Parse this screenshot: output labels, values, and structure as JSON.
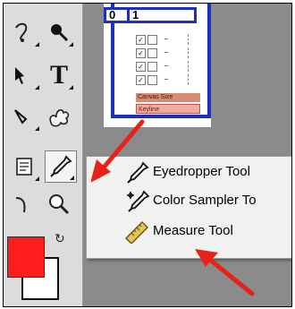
{
  "toolbox": {
    "tools": [
      {
        "name": "lasso-tool",
        "icon": "lasso-icon"
      },
      {
        "name": "quick-select-tool",
        "icon": "quick-select-icon"
      },
      {
        "name": "path-select-tool",
        "icon": "path-select-icon"
      },
      {
        "name": "type-tool",
        "icon": "type-icon",
        "glyph": "T"
      },
      {
        "name": "pen-tool",
        "icon": "pen-icon"
      },
      {
        "name": "custom-shape-tool",
        "icon": "custom-shape-icon"
      },
      {
        "name": "notes-tool",
        "icon": "notes-icon"
      },
      {
        "name": "eyedropper-tool",
        "icon": "eyedropper-icon",
        "selected": true
      },
      {
        "name": "hand-tool",
        "icon": "hand-icon"
      },
      {
        "name": "zoom-tool",
        "icon": "zoom-icon"
      }
    ],
    "foreground_color": "#ff1e1e",
    "background_color": "#ffffff"
  },
  "document": {
    "tabs": [
      "0",
      "1"
    ],
    "layer_labels": [
      "Canvas Size",
      "Keyline"
    ]
  },
  "flyout_menu": {
    "items": [
      {
        "label": "Eyedropper Tool",
        "icon": "eyedropper-icon",
        "current": true
      },
      {
        "label": "Color Sampler To",
        "icon": "color-sampler-icon"
      },
      {
        "label": "Measure Tool",
        "icon": "ruler-icon"
      }
    ]
  },
  "annotation_color": "#e8211b"
}
